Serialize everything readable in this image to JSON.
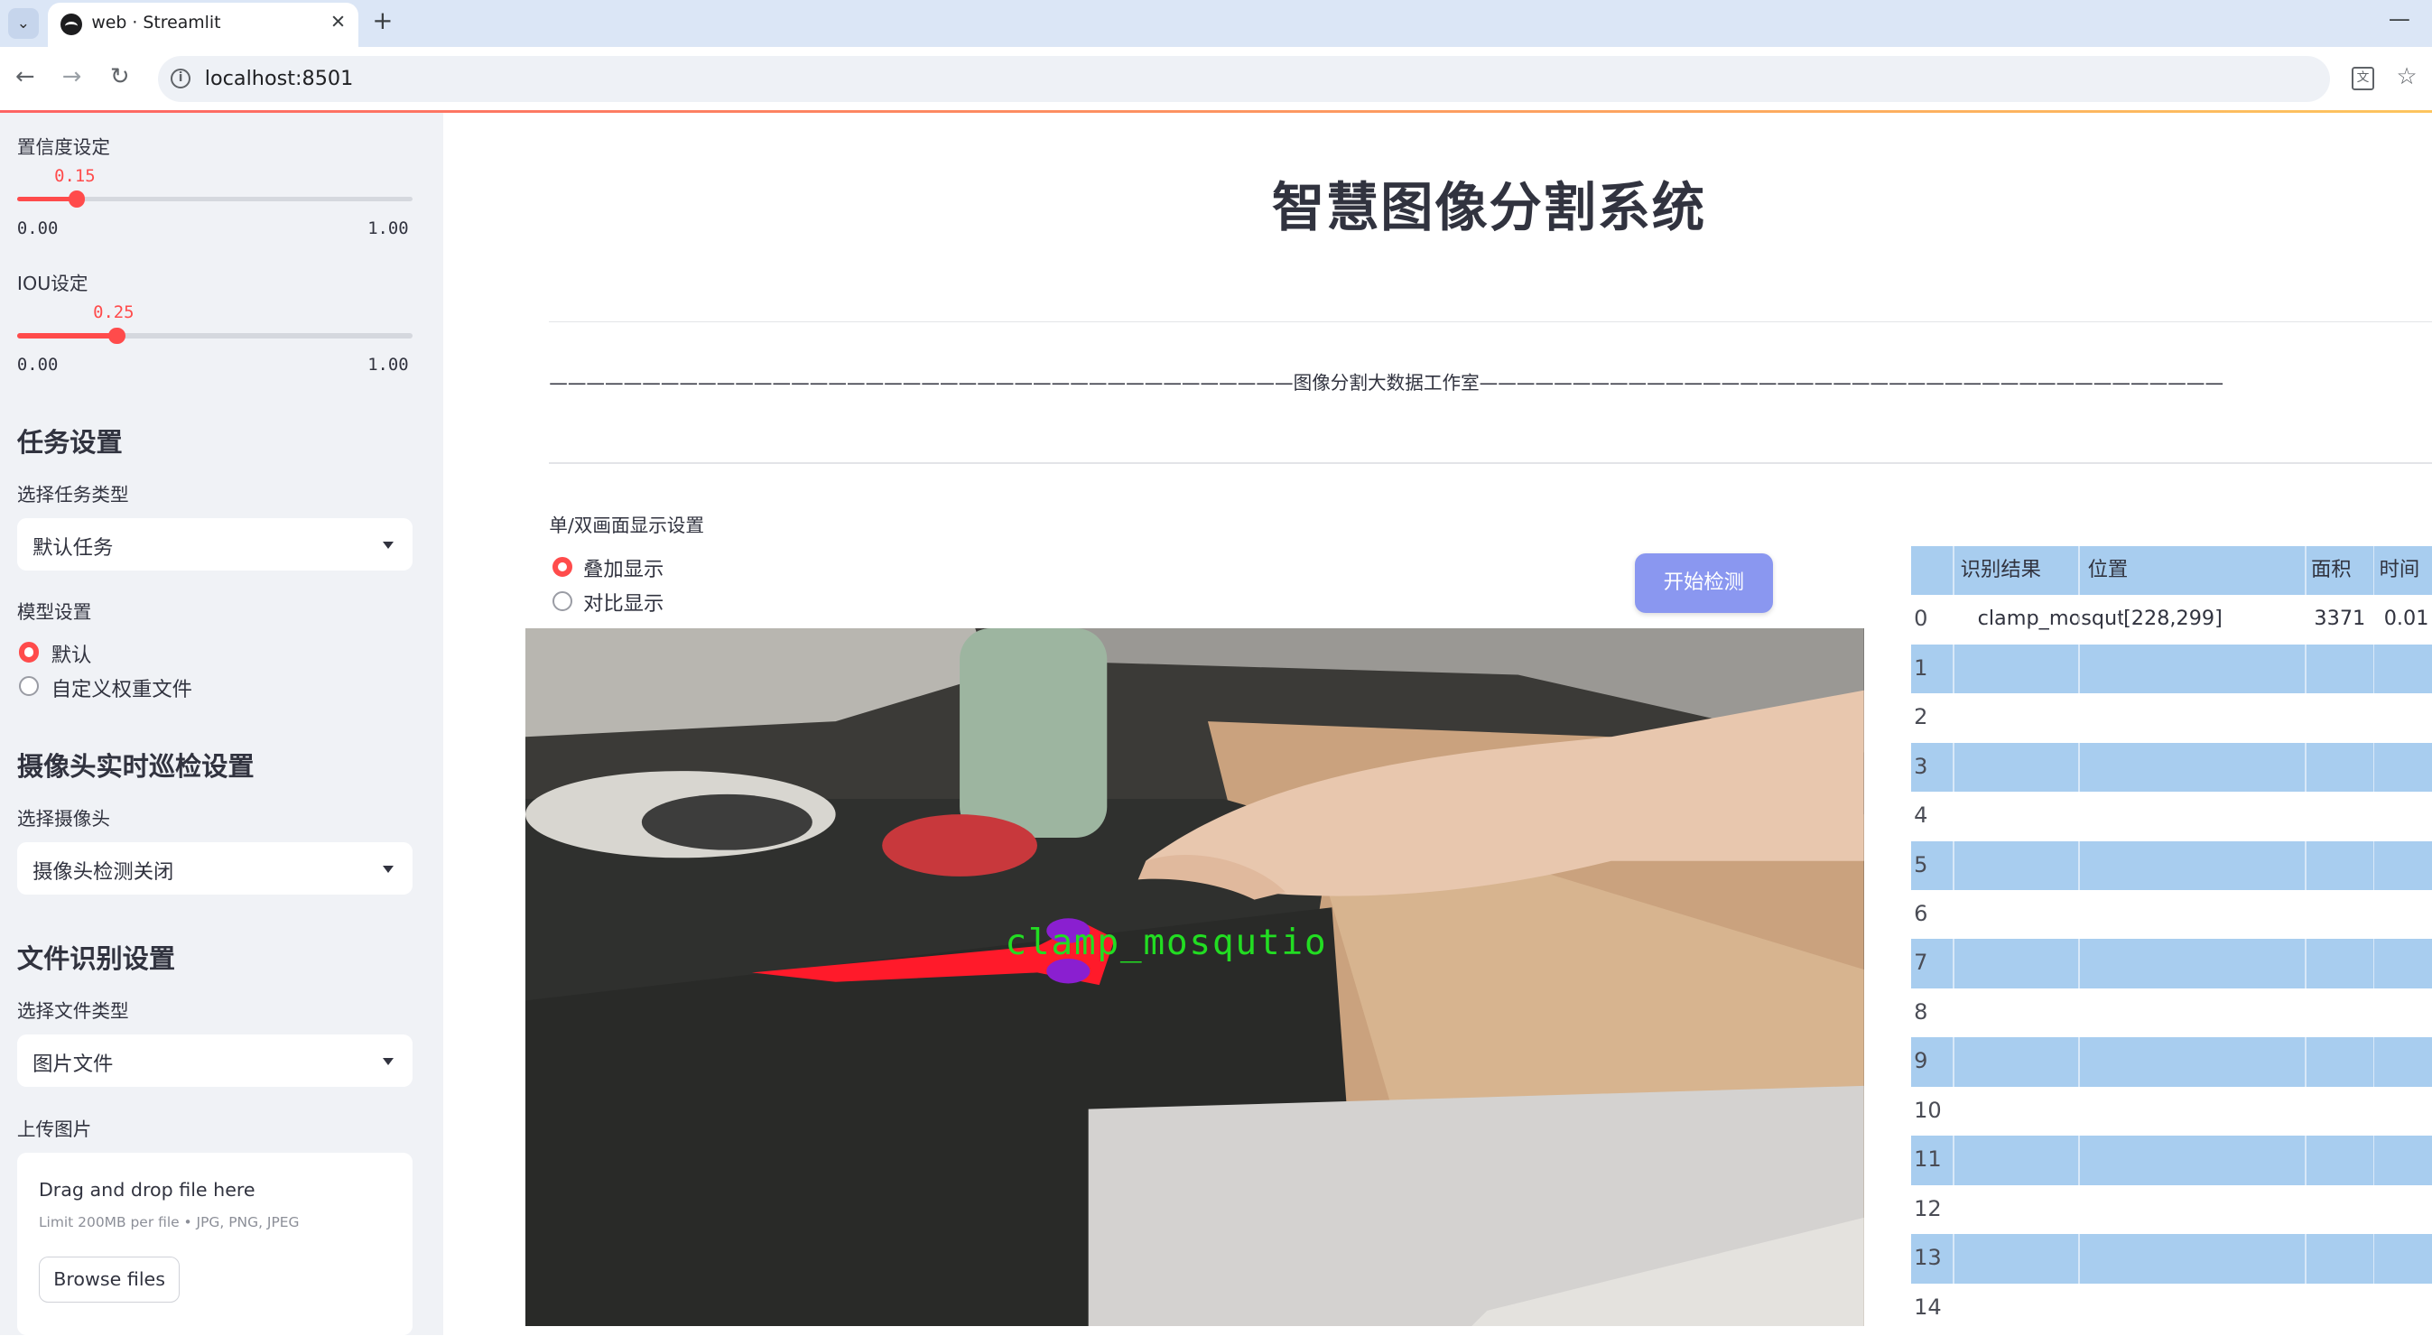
{
  "browser": {
    "tab_title": "web · Streamlit",
    "url": "localhost:8501"
  },
  "sidebar": {
    "confidence": {
      "label": "置信度设定",
      "value": "0.15",
      "min": "0.00",
      "max": "1.00",
      "fraction": 0.15
    },
    "iou": {
      "label": "IOU设定",
      "value": "0.25",
      "min": "0.00",
      "max": "1.00",
      "fraction": 0.25
    },
    "task_heading": "任务设置",
    "task_type_label": "选择任务类型",
    "task_type_value": "默认任务",
    "model_label": "模型设置",
    "model_options": [
      "默认",
      "自定义权重文件"
    ],
    "model_selected": 0,
    "camera_heading": "摄像头实时巡检设置",
    "camera_label": "选择摄像头",
    "camera_value": "摄像头检测关闭",
    "file_heading": "文件识别设置",
    "file_type_label": "选择文件类型",
    "file_type_value": "图片文件",
    "upload_label": "上传图片",
    "upload_title": "Drag and drop file here",
    "upload_limit": "Limit 200MB per file • JPG, PNG, JPEG",
    "browse_label": "Browse files"
  },
  "main": {
    "title": "智慧图像分割系统",
    "divider_text": "————————————————————————————————————————图像分割大数据工作室————————————————————————————————————————",
    "display_label": "单/双画面显示设置",
    "display_options": [
      "叠加显示",
      "对比显示"
    ],
    "display_selected": 0,
    "start_button": "开始检测",
    "detection_label": "clamp_mosqutio"
  },
  "table": {
    "columns": [
      "",
      "识别结果",
      "位置",
      "面积",
      "时间"
    ],
    "rows": [
      [
        "0",
        "clamp_mosqutio",
        "[228,299]",
        "3371",
        "0.01"
      ],
      [
        "1",
        "",
        "",
        "",
        ""
      ],
      [
        "2",
        "",
        "",
        "",
        ""
      ],
      [
        "3",
        "",
        "",
        "",
        ""
      ],
      [
        "4",
        "",
        "",
        "",
        ""
      ],
      [
        "5",
        "",
        "",
        "",
        ""
      ],
      [
        "6",
        "",
        "",
        "",
        ""
      ],
      [
        "7",
        "",
        "",
        "",
        ""
      ],
      [
        "8",
        "",
        "",
        "",
        ""
      ],
      [
        "9",
        "",
        "",
        "",
        ""
      ],
      [
        "10",
        "",
        "",
        "",
        ""
      ],
      [
        "11",
        "",
        "",
        "",
        ""
      ],
      [
        "12",
        "",
        "",
        "",
        ""
      ],
      [
        "13",
        "",
        "",
        "",
        ""
      ],
      [
        "14",
        "",
        "",
        "",
        ""
      ]
    ]
  },
  "colors": {
    "accent": "#ff4b4b",
    "sidebar_bg": "#f0f2f6",
    "table_blue": "#a8cdef",
    "button": "#8a97f0",
    "mask": "#ff1a2a",
    "label_green": "#22dd22"
  }
}
